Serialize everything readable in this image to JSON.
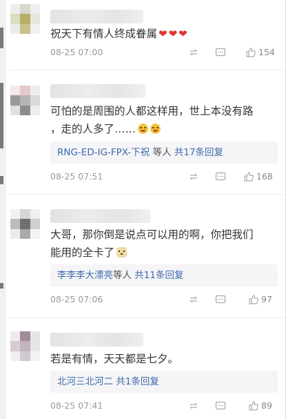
{
  "comments": [
    {
      "text": "祝天下有情人终成眷属",
      "reply_users": "",
      "reply_mid": "",
      "reply_total": "",
      "time": "08-25 07:00",
      "likes": "154"
    },
    {
      "text_line1": "可怕的是周围的人都这样用，世上本没有路",
      "text_line2": "，走的人多了……",
      "reply_users": "RNG-ED-IG-FPX-下祝",
      "reply_mid": " 等人 ",
      "reply_total": "共17条回复",
      "time": "08-25 07:51",
      "likes": "168"
    },
    {
      "text_line1": "大哥，那你倒是说点可以用的啊，你把我们",
      "text_line2": "能用的全卡了",
      "reply_users": "李李李大漂亮",
      "reply_mid": "等人 ",
      "reply_total": "共11条回复",
      "time": "08-25 07:06",
      "likes": "97"
    },
    {
      "text": "若是有情，天天都是七夕。",
      "reply_users": "北河三北河二",
      "reply_mid": " ",
      "reply_total": "共1条回复",
      "time": "08-25 07:41",
      "likes": "89"
    }
  ],
  "icons": {
    "share": "repost-icon",
    "comment": "comment-icon",
    "like": "thumbs-up-icon",
    "emoji_laugh": "laughing-emoji-icon",
    "emoji_dog": "dog-face-emoji-icon",
    "heart": "red-heart-icon"
  },
  "colors": {
    "link": "#3f6aad",
    "meta": "#999999",
    "reply_bg": "#f5f5f7",
    "heart": "#e0362c"
  }
}
